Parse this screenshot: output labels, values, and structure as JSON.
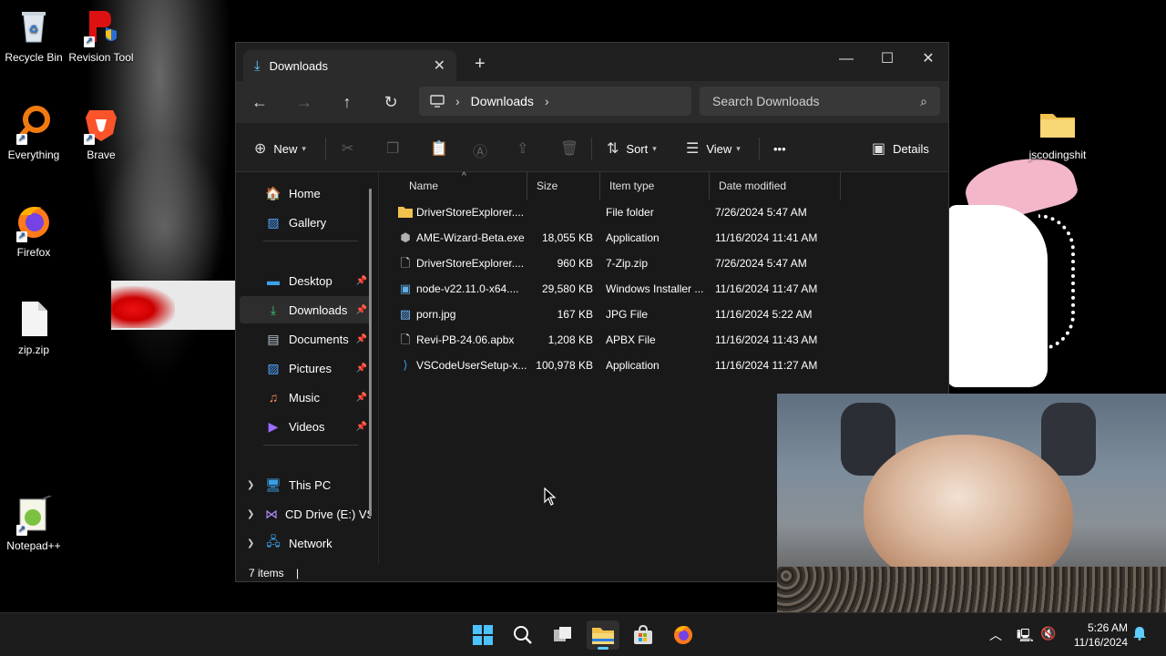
{
  "desktop": {
    "icons": [
      {
        "label": "Recycle Bin"
      },
      {
        "label": "Revision Tool"
      },
      {
        "label": "Everything"
      },
      {
        "label": "Brave"
      },
      {
        "label": "Firefox"
      },
      {
        "label": "zip.zip"
      },
      {
        "label": "Notepad++"
      },
      {
        "label": "jscodingshit"
      }
    ]
  },
  "window": {
    "tab_label": "Downloads",
    "breadcrumb": "Downloads",
    "search_placeholder": "Search Downloads",
    "commands": {
      "new": "New",
      "sort": "Sort",
      "view": "View",
      "more": "•••",
      "details": "Details"
    },
    "sidebar": {
      "home": "Home",
      "gallery": "Gallery",
      "desktop": "Desktop",
      "downloads": "Downloads",
      "documents": "Documents",
      "pictures": "Pictures",
      "music": "Music",
      "videos": "Videos",
      "this_pc": "This PC",
      "cd_drive": "CD Drive (E:) VSz",
      "network": "Network"
    },
    "columns": {
      "name": "Name",
      "size": "Size",
      "type": "Item type",
      "date": "Date modified"
    },
    "files": [
      {
        "name": "DriverStoreExplorer....",
        "size": "",
        "type": "File folder",
        "date": "7/26/2024 5:47 AM",
        "icon": "folder-icon"
      },
      {
        "name": "AME-Wizard-Beta.exe",
        "size": "18,055 KB",
        "type": "Application",
        "date": "11/16/2024 11:41 AM",
        "icon": "exe-icon"
      },
      {
        "name": "DriverStoreExplorer....",
        "size": "960 KB",
        "type": "7-Zip.zip",
        "date": "7/26/2024 5:47 AM",
        "icon": "document-icon"
      },
      {
        "name": "node-v22.11.0-x64....",
        "size": "29,580 KB",
        "type": "Windows Installer ...",
        "date": "11/16/2024 11:47 AM",
        "icon": "installer-icon"
      },
      {
        "name": "porn.jpg",
        "size": "167 KB",
        "type": "JPG File",
        "date": "11/16/2024 5:22 AM",
        "icon": "image-icon"
      },
      {
        "name": "Revi-PB-24.06.apbx",
        "size": "1,208 KB",
        "type": "APBX File",
        "date": "11/16/2024 11:43 AM",
        "icon": "document-icon"
      },
      {
        "name": "VSCodeUserSetup-x...",
        "size": "100,978 KB",
        "type": "Application",
        "date": "11/16/2024 11:27 AM",
        "icon": "vscode-icon"
      }
    ],
    "status": "7 items"
  },
  "taskbar": {
    "time": "5:26 AM",
    "date": "11/16/2024"
  },
  "colors": {
    "accent": "#60cdff",
    "window_bg": "#191919",
    "folder": "#f2c14e"
  }
}
